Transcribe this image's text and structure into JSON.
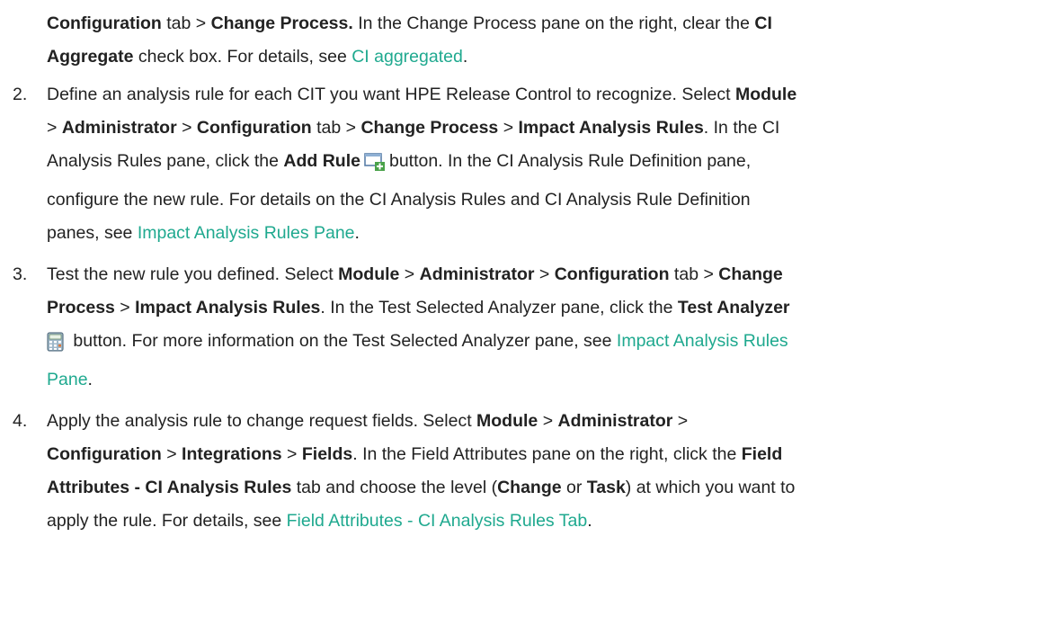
{
  "intro": {
    "t1": "Configuration",
    "t2": " tab > ",
    "t3": "Change Process.",
    "t4": " In the Change Process pane on the right, clear the ",
    "t5": "CI",
    "t6": "Aggregate",
    "t7": " check box. For details, see ",
    "link": "CI aggregated",
    "t8": "."
  },
  "item2": {
    "num": "2.",
    "a1": "Define an analysis rule for each CIT you want HPE Release Control to recognize. Select ",
    "a2": "Module",
    "a3": "> ",
    "a4": "Administrator",
    "a5": " > ",
    "a6": "Configuration",
    "a7": " tab > ",
    "a8": "Change Process",
    "a9": " > ",
    "a10": "Impact Analysis Rules",
    "a11": ". In the CI",
    "a12": "Analysis Rules pane, click the ",
    "a13": "Add Rule",
    "a14": "button. In the CI Analysis Rule Definition pane,",
    "a15": "configure the new rule. For details on the CI Analysis Rules and CI Analysis Rule Definition",
    "a16": "panes, see ",
    "link": "Impact Analysis Rules Pane",
    "a17": ".",
    "icon": "add-rule-icon"
  },
  "item3": {
    "num": "3.",
    "b1": "Test the new rule you defined. Select ",
    "b2": "Module",
    "b3": " > ",
    "b4": "Administrator",
    "b5": " > ",
    "b6": "Configuration",
    "b7": " tab > ",
    "b8": "Change",
    "b9": "Process",
    "b10": " > ",
    "b11": "Impact Analysis Rules",
    "b12": ". In the Test Selected Analyzer pane, click the ",
    "b13": "Test Analyzer",
    "b14": " button. For more information on the Test Selected Analyzer pane, see ",
    "link1": "Impact Analysis Rules",
    "link2": "Pane",
    "b15": ".",
    "icon": "test-analyzer-icon"
  },
  "item4": {
    "num": "4.",
    "c1": "Apply the analysis rule to change request fields. Select ",
    "c2": "Module",
    "c3": " > ",
    "c4": "Administrator",
    "c5": " >",
    "c6": "Configuration",
    "c7": " > ",
    "c8": "Integrations",
    "c9": " > ",
    "c10": "Fields",
    "c11": ". In the Field Attributes pane on the right, click the ",
    "c12": "Field",
    "c13": "Attributes - CI Analysis Rules",
    "c14": " tab and choose the level (",
    "c15": "Change",
    "c16": " or ",
    "c17": "Task",
    "c18": ") at which you want to",
    "c19": "apply the rule. For details, see ",
    "link": "Field Attributes - CI Analysis Rules Tab",
    "c20": "."
  },
  "colors": {
    "text": "#222222",
    "link": "#1fa98f"
  }
}
